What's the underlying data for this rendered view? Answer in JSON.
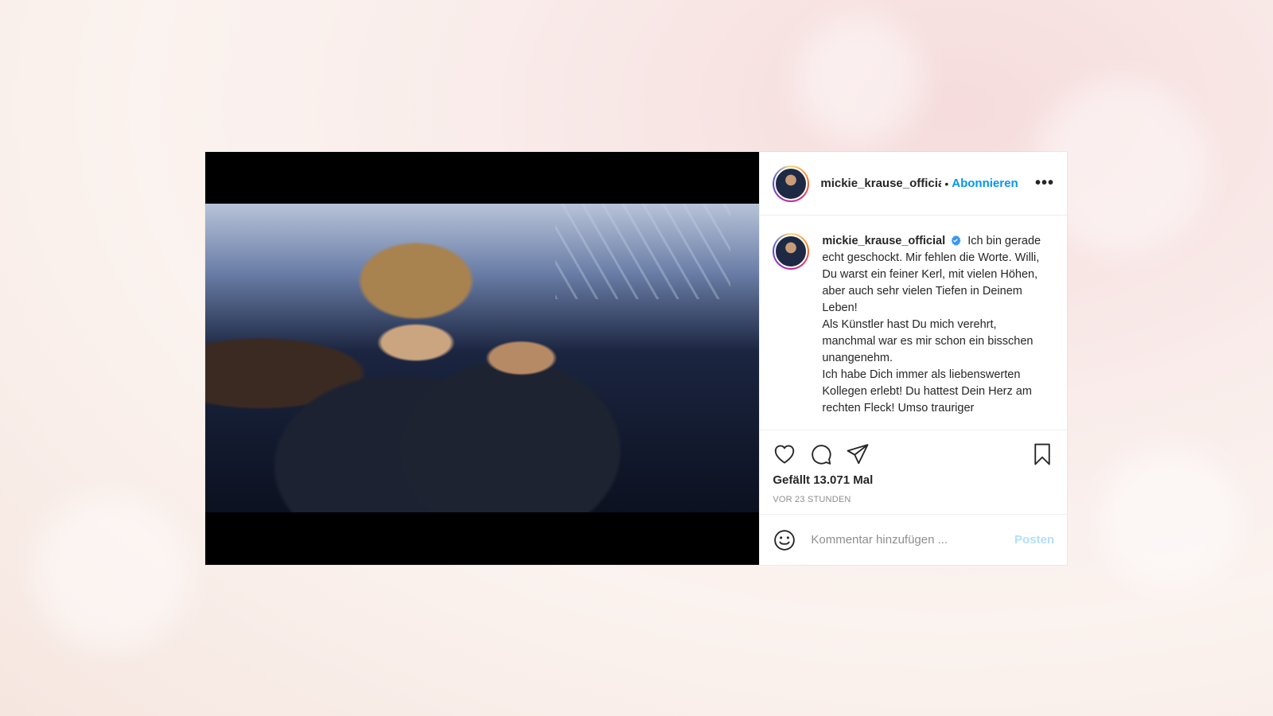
{
  "post": {
    "header": {
      "username": "mickie_krause_official",
      "separator": "•",
      "follow_label": "Abonnieren",
      "more_icon": "more-options-icon"
    },
    "caption": {
      "username": "mickie_krause_official",
      "verified_icon": "verified-badge-icon",
      "text_lines": [
        "Ich bin gerade echt geschockt. Mir fehlen die Worte. Willi, Du warst ein feiner Kerl, mit vielen Höhen, aber auch sehr vielen Tiefen in Deinem Leben!",
        "Als Künstler hast Du mich verehrt, manchmal war es mir schon ein bisschen unangenehm.",
        "Ich habe Dich immer als liebenswerten Kollegen erlebt! Du hattest Dein Herz am rechten Fleck! Umso trauriger"
      ]
    },
    "actions": {
      "icons": [
        "heart-icon",
        "comment-icon",
        "share-icon",
        "bookmark-icon"
      ],
      "likes": "Gefällt 13.071 Mal",
      "timestamp": "VOR 23 STUNDEN"
    },
    "comment": {
      "emoji_icon": "emoji-icon",
      "placeholder": "Kommentar hinzufügen ...",
      "post_label": "Posten"
    },
    "colors": {
      "accent": "#0095f6",
      "post_disabled": "#b2dffc",
      "text": "#262626",
      "muted": "#8e8e8e"
    }
  }
}
